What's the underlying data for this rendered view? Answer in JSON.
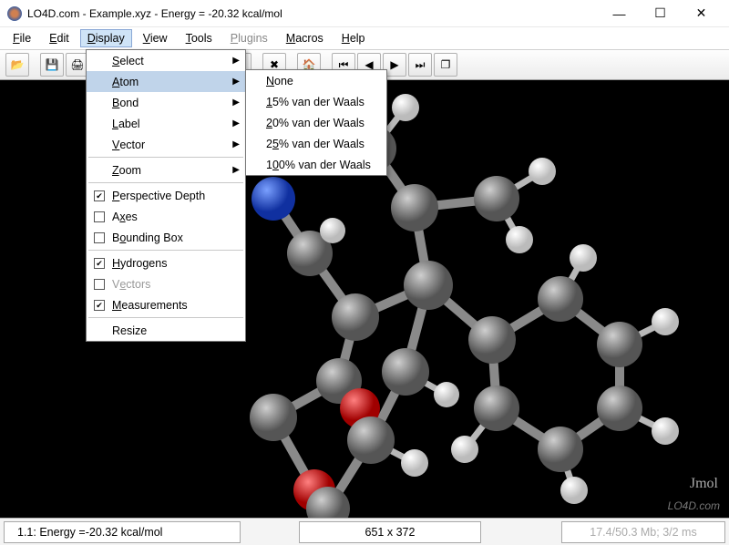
{
  "titlebar": {
    "text": "LO4D.com - Example.xyz - Energy =      -20.32 kcal/mol"
  },
  "win_controls": {
    "min": "—",
    "max": "☐",
    "close": "✕"
  },
  "menubar": [
    {
      "name": "file",
      "prefix": "",
      "u": "F",
      "rest": "ile",
      "disabled": false,
      "open": false
    },
    {
      "name": "edit",
      "prefix": "",
      "u": "E",
      "rest": "dit",
      "disabled": false,
      "open": false
    },
    {
      "name": "display",
      "prefix": "",
      "u": "D",
      "rest": "isplay",
      "disabled": false,
      "open": true
    },
    {
      "name": "view",
      "prefix": "",
      "u": "V",
      "rest": "iew",
      "disabled": false,
      "open": false
    },
    {
      "name": "tools",
      "prefix": "",
      "u": "T",
      "rest": "ools",
      "disabled": false,
      "open": false
    },
    {
      "name": "plugins",
      "prefix": "",
      "u": "P",
      "rest": "lugins",
      "disabled": true,
      "open": false
    },
    {
      "name": "macros",
      "prefix": "",
      "u": "M",
      "rest": "acros",
      "disabled": false,
      "open": false
    },
    {
      "name": "help",
      "prefix": "",
      "u": "H",
      "rest": "elp",
      "disabled": false,
      "open": false
    }
  ],
  "dropdown": {
    "items": [
      {
        "type": "sub",
        "u": "S",
        "rest": "elect",
        "name": "select"
      },
      {
        "type": "sub",
        "u": "A",
        "rest": "tom",
        "name": "atom",
        "selected": true
      },
      {
        "type": "sub",
        "u": "B",
        "rest": "ond",
        "name": "bond"
      },
      {
        "type": "sub",
        "u": "L",
        "rest": "abel",
        "name": "label"
      },
      {
        "type": "sub",
        "u": "V",
        "rest": "ector",
        "name": "vector"
      },
      {
        "type": "sep"
      },
      {
        "type": "sub",
        "u": "Z",
        "rest": "oom",
        "name": "zoom"
      },
      {
        "type": "sep"
      },
      {
        "type": "check",
        "checked": true,
        "u": "P",
        "rest": "erspective Depth",
        "name": "perspective-depth"
      },
      {
        "type": "check",
        "checked": false,
        "prefix": "A",
        "u": "x",
        "rest": "es",
        "name": "axes"
      },
      {
        "type": "check",
        "checked": false,
        "prefix": "B",
        "u": "o",
        "rest": "unding Box",
        "name": "bounding-box"
      },
      {
        "type": "sep"
      },
      {
        "type": "check",
        "checked": true,
        "u": "H",
        "rest": "ydrogens",
        "name": "hydrogens"
      },
      {
        "type": "check",
        "checked": false,
        "prefix": "V",
        "u": "e",
        "rest": "ctors",
        "name": "vectors",
        "disabled": true
      },
      {
        "type": "check",
        "checked": true,
        "u": "M",
        "rest": "easurements",
        "name": "measurements"
      },
      {
        "type": "sep"
      },
      {
        "type": "plain",
        "label": "Resize",
        "name": "resize"
      }
    ]
  },
  "submenu": {
    "items": [
      {
        "u": "N",
        "rest": "one",
        "name": "atom-none"
      },
      {
        "u": "1",
        "rest": "5% van der Waals",
        "name": "atom-15"
      },
      {
        "u": "2",
        "rest": "0% van der Waals",
        "name": "atom-20"
      },
      {
        "prefix": "2",
        "u": "5",
        "rest": "% van der Waals",
        "name": "atom-25"
      },
      {
        "prefix": "1",
        "u": "0",
        "rest": "0% van der Waals",
        "name": "atom-100"
      }
    ]
  },
  "toolbar_icons": [
    "open-icon",
    "blank",
    "save-icon",
    "print-icon",
    "blank",
    "undo-icon",
    "redo-icon",
    "select-icon",
    "measure-icon",
    "rotate-icon",
    "label-icon",
    "blank",
    "config-icon",
    "blank",
    "home-icon",
    "blank",
    "first-icon",
    "prev-icon",
    "next-icon",
    "last-icon",
    "frames-icon"
  ],
  "status": {
    "left_prefix": "1.1: Energy =   ",
    "energy": "-20.32 kcal/mol",
    "dimensions": "651 x 372",
    "right": "17.4/50.3 Mb;   3/2 ms"
  },
  "viewport": {
    "jmol": "Jmol",
    "watermark": "LO4D.com"
  }
}
